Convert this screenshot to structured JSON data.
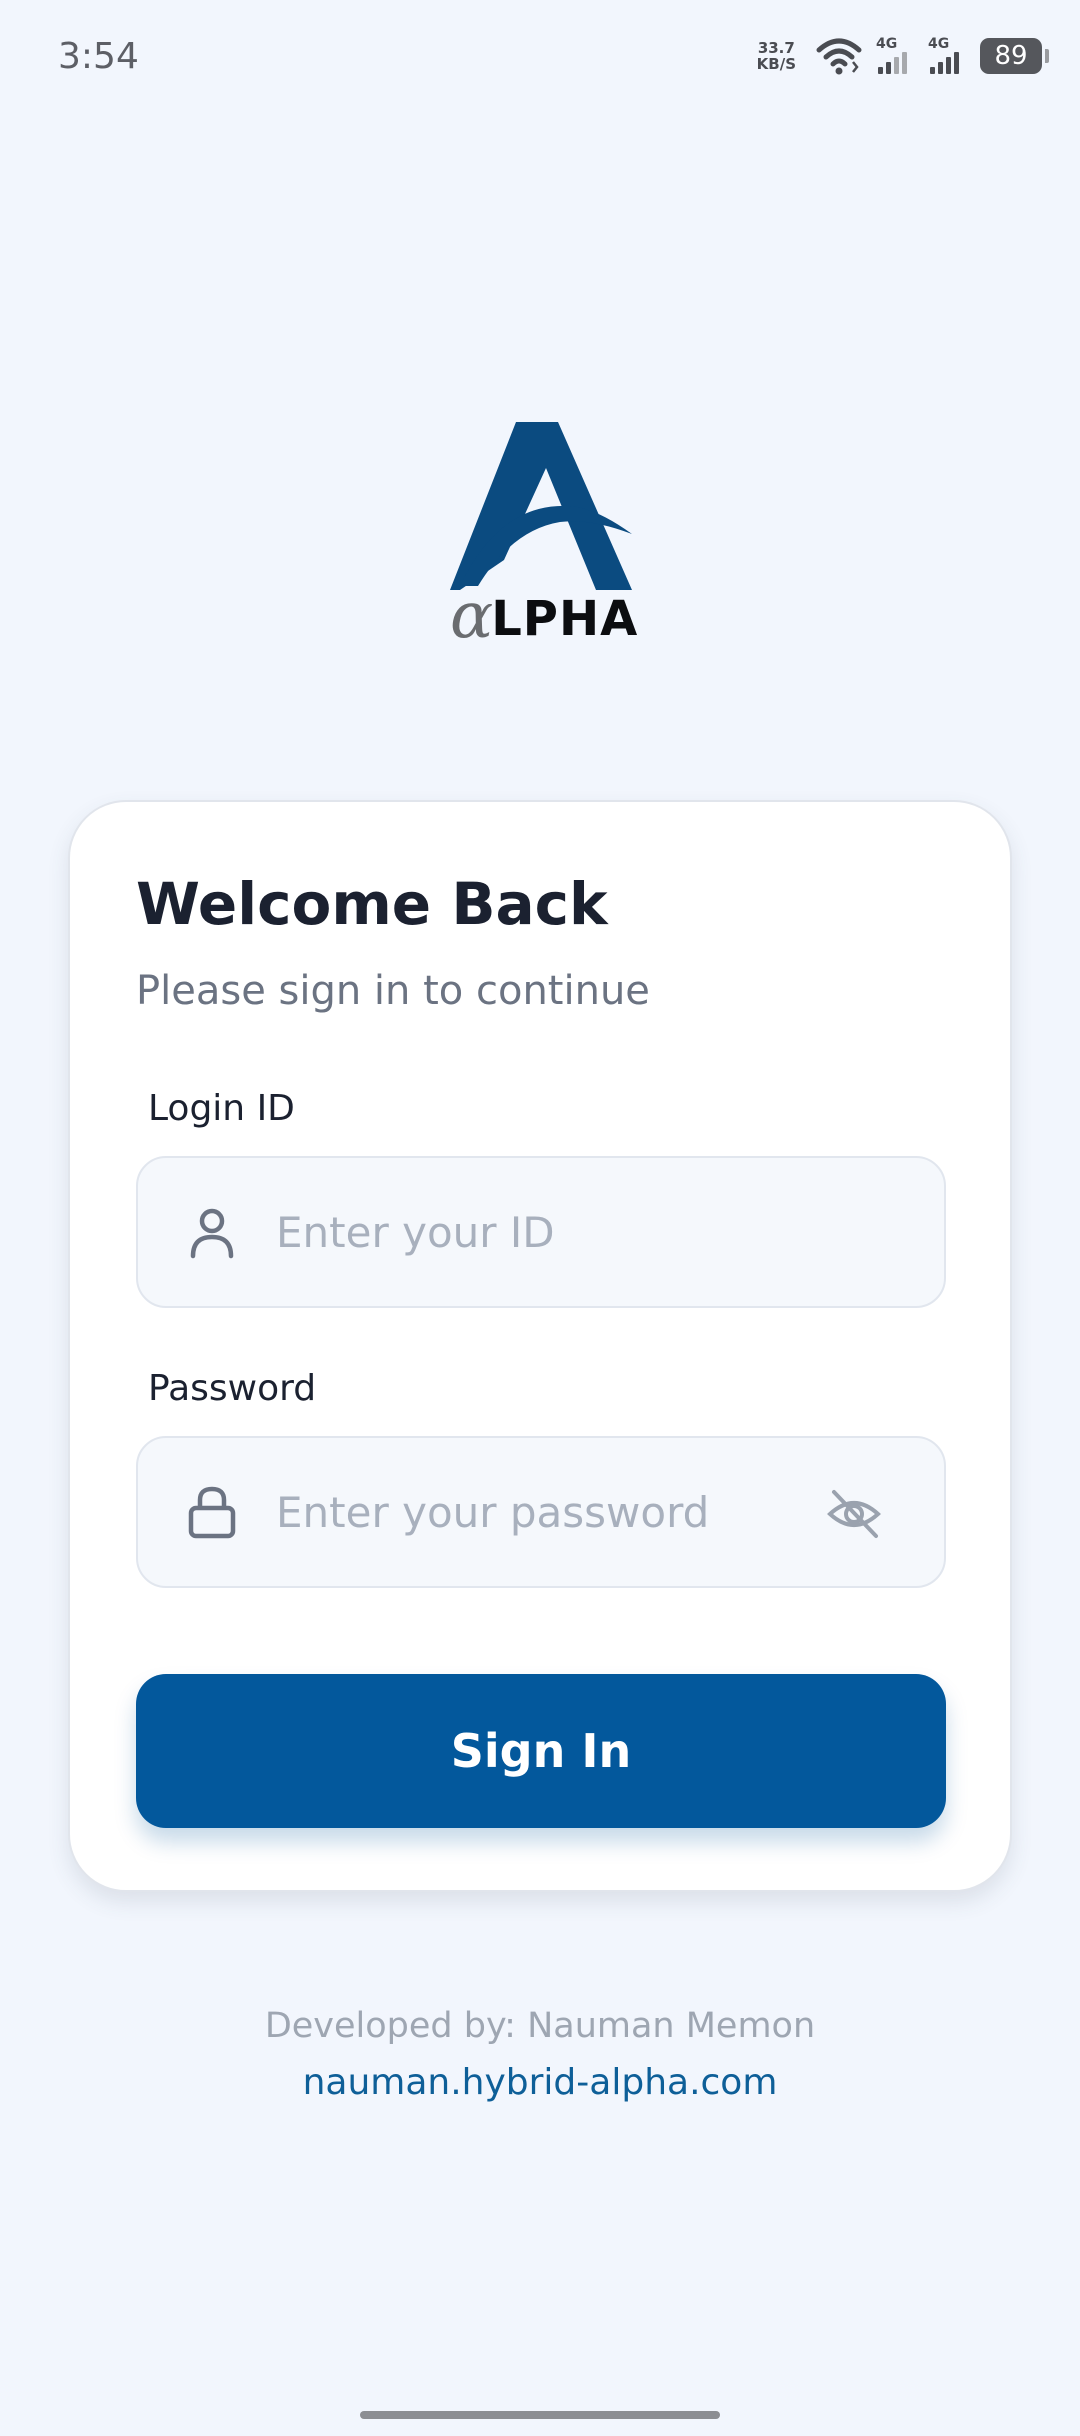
{
  "status_bar": {
    "time": "3:54",
    "net_speed_value": "33.7",
    "net_speed_unit": "KB/S",
    "signal_1_label": "4G",
    "signal_2_label": "4G",
    "battery": "89",
    "icons": [
      "wifi-icon",
      "signal-icon",
      "signal-icon",
      "battery-icon"
    ]
  },
  "logo": {
    "alpha_glyph": "α",
    "text": "LPHA"
  },
  "card": {
    "title": "Welcome Back",
    "subtitle": "Please sign in to continue",
    "login_id": {
      "label": "Login ID",
      "placeholder": "Enter your ID",
      "value": "",
      "icon": "user-icon"
    },
    "password": {
      "label": "Password",
      "placeholder": "Enter your password",
      "value": "",
      "icon": "lock-icon",
      "toggle_icon": "eye-off-icon"
    },
    "sign_in_label": "Sign In"
  },
  "footer": {
    "developed_by": "Developed by: Nauman Memon",
    "link": "nauman.hybrid-alpha.com"
  },
  "colors": {
    "background": "#f2f6fd",
    "primary": "#03589c",
    "link": "#0e5f98",
    "logo_blue": "#0b4b80"
  }
}
